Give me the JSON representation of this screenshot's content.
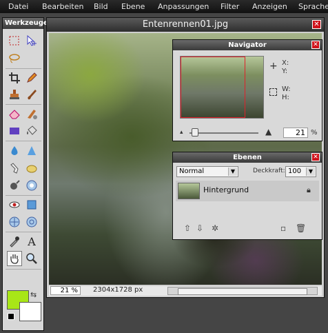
{
  "menu": [
    "Datei",
    "Bearbeiten",
    "Bild",
    "Ebene",
    "Anpassungen",
    "Filter",
    "Anzeigen",
    "Sprache"
  ],
  "tools_panel": {
    "title": "Werkzeuge",
    "tools": [
      "marquee",
      "move",
      "lasso",
      "magic-wand",
      "crop",
      "pencil",
      "stamp",
      "brush",
      "eraser",
      "smudge",
      "rect-fill",
      "bucket",
      "water-drop",
      "sharpen",
      "hand-finger",
      "sponge",
      "burn",
      "bloat",
      "red-eye",
      "shape",
      "pinch",
      "spherize",
      "eyedropper",
      "text",
      "hand",
      "zoom"
    ],
    "fg_color": "#a8e617",
    "bg_color": "#ffffff"
  },
  "image_window": {
    "title": "Entenrennen01.jpg",
    "zoom": "21 %",
    "dimensions": "2304x1728 px"
  },
  "navigator": {
    "title": "Navigator",
    "x_label": "X:",
    "y_label": "Y:",
    "w_label": "W:",
    "h_label": "H:",
    "zoom_value": "21",
    "percent": "%"
  },
  "layers": {
    "title": "Ebenen",
    "blend_mode": "Normal",
    "opacity_label": "Deckkraft:",
    "opacity_value": "100",
    "layer_name": "Hintergrund"
  }
}
